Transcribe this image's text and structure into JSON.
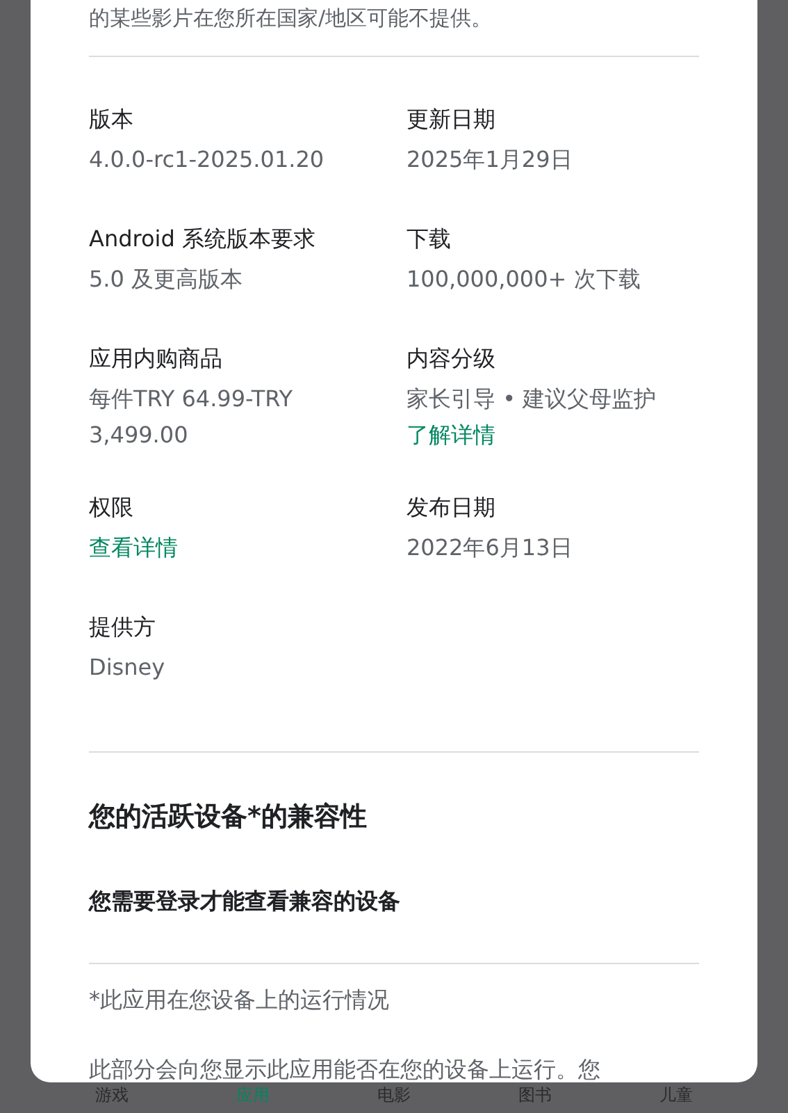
{
  "intro_text": "的某些影片在您所在国家/地区可能不提供。",
  "details": [
    {
      "label": "版本",
      "value": "4.0.0-rc1-2025.01.20"
    },
    {
      "label": "更新日期",
      "value": "2025年1月29日"
    },
    {
      "label": "Android 系统版本要求",
      "value": "5.0 及更高版本"
    },
    {
      "label": "下载",
      "value": "100,000,000+ 次下载"
    },
    {
      "label": "应用内购商品",
      "value": "每件TRY 64.99-TRY 3,499.00"
    },
    {
      "label": "内容分级",
      "value": "家长引导 • 建议父母监护",
      "link": "了解详情"
    },
    {
      "label": "权限",
      "link": "查看详情"
    },
    {
      "label": "发布日期",
      "value": "2022年6月13日"
    },
    {
      "label": "提供方",
      "value": "Disney"
    }
  ],
  "compatibility": {
    "title": "您的活跃设备*的兼容性",
    "message": "您需要登录才能查看兼容的设备",
    "footnote": "*此应用在您设备上的运行情况",
    "description": "此部分会向您显示此应用能否在您的设备上运行。您"
  },
  "bottom_nav": [
    {
      "label": "游戏",
      "selected": false
    },
    {
      "label": "应用",
      "selected": true
    },
    {
      "label": "电影",
      "selected": false
    },
    {
      "label": "图书",
      "selected": false
    },
    {
      "label": "儿童",
      "selected": false
    }
  ]
}
